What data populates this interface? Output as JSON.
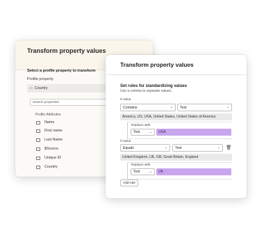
{
  "back_panel": {
    "title": "Transform property values",
    "section_title": "Select a profile property to transform",
    "property_label": "Profile property",
    "property_value": "Country",
    "search_placeholder": "Search properties",
    "attributes_header": "Profile Attributes",
    "attributes": [
      "Name",
      "First name",
      "Last Name",
      "$Source",
      "Unique ID",
      "Country"
    ]
  },
  "front_panel": {
    "title": "Transform property values",
    "rules_title": "Set rules for standardizing values",
    "rules_subtitle": "Use a comma to separate values.",
    "rules": [
      {
        "if_label": "If value",
        "operator": "Contains",
        "type": "Text",
        "values": "America, US, USA, United States, United States of America",
        "replace_label": "Replace with",
        "replace_type": "Text",
        "replace_value": "USA"
      },
      {
        "if_label": "If value",
        "operator": "Equals",
        "type": "Text",
        "values": "United Kingdom, UK, GB, Great Britain, England",
        "replace_label": "Replace with",
        "replace_type": "Text",
        "replace_value": "UK"
      }
    ],
    "add_rule_label": "Add rule"
  }
}
